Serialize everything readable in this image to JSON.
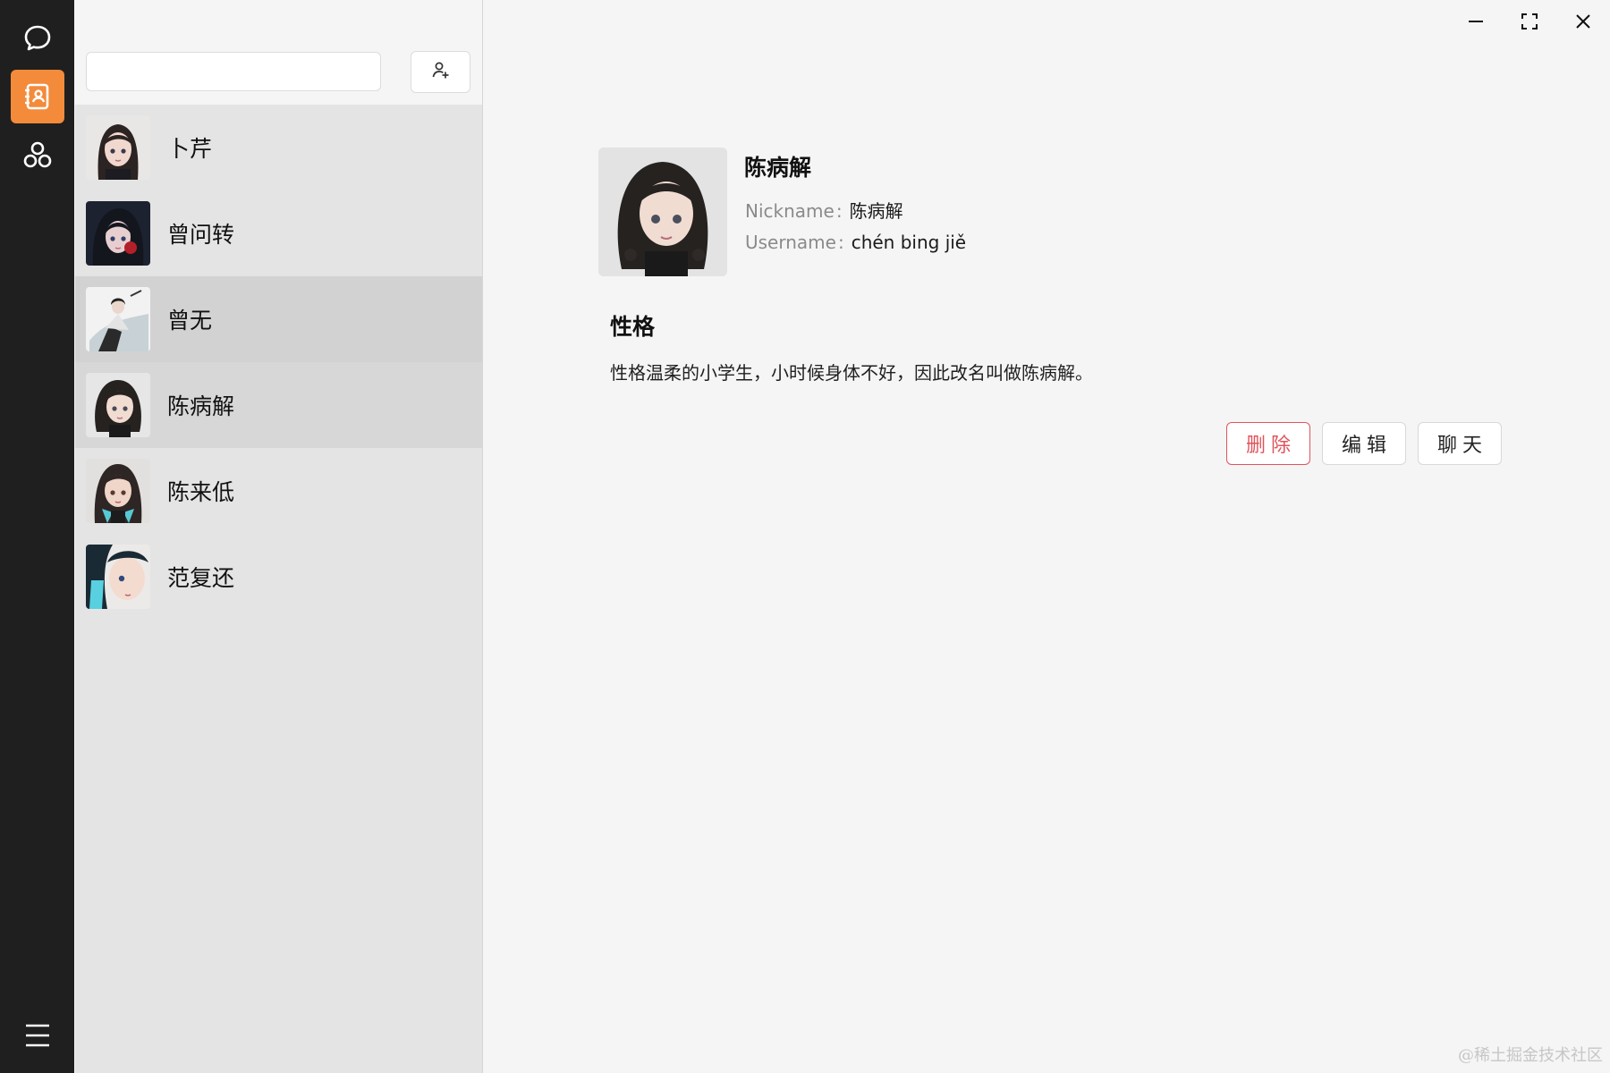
{
  "sidebar": {
    "items": [
      {
        "name": "chat",
        "icon": "chat-bubble-icon",
        "active": false
      },
      {
        "name": "contacts",
        "icon": "contact-book-icon",
        "active": true
      },
      {
        "name": "groups",
        "icon": "groups-icon",
        "active": false
      }
    ],
    "menu_icon": "hamburger-menu-icon",
    "accent": "#f38b3b"
  },
  "search": {
    "value": "",
    "placeholder": "",
    "add_icon": "add-user-icon"
  },
  "contacts": [
    {
      "name": "卜芹",
      "avatar": "avatar-icon",
      "state": "normal"
    },
    {
      "name": "曾问转",
      "avatar": "avatar-icon",
      "state": "normal"
    },
    {
      "name": "曾无",
      "avatar": "avatar-icon",
      "state": "hover"
    },
    {
      "name": "陈病解",
      "avatar": "avatar-icon",
      "state": "selected"
    },
    {
      "name": "陈来低",
      "avatar": "avatar-icon",
      "state": "normal"
    },
    {
      "name": "范复还",
      "avatar": "avatar-icon",
      "state": "normal"
    }
  ],
  "window_controls": {
    "minimize_icon": "minimize-icon",
    "maximize_icon": "maximize-icon",
    "close_icon": "close-icon"
  },
  "detail": {
    "name": "陈病解",
    "nickname_label": "Nickname",
    "nickname_value": "陈病解",
    "username_label": "Username",
    "username_value": "chén bing jiě",
    "colon": ":",
    "section_title": "性格",
    "section_body": "性格温柔的小学生，小时候身体不好，因此改名叫做陈病解。",
    "buttons": {
      "delete": "删除",
      "edit": "编辑",
      "chat": "聊天"
    },
    "danger_color": "#e0545b"
  },
  "watermark": "@稀土掘金技术社区"
}
